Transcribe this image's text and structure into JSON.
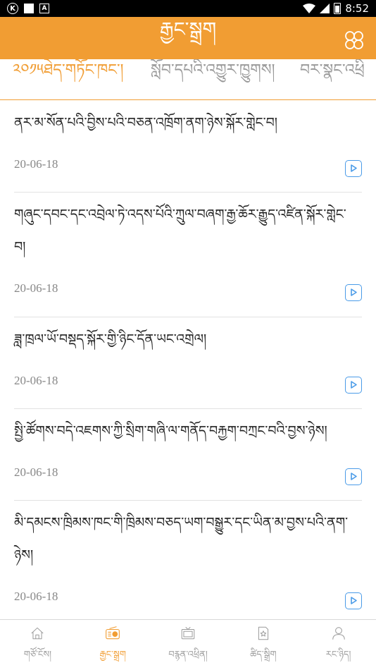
{
  "status_bar": {
    "time": "8:52",
    "left_icons": [
      "k-circle-icon",
      "square-icon",
      "a-box-icon"
    ],
    "right_icons": [
      "wifi-icon",
      "signal-icon",
      "battery-icon"
    ]
  },
  "header": {
    "title": "རྒྱང་སྒྲག",
    "menu_icon": "grid-menu-icon",
    "accent_color": "#f19d33"
  },
  "tabs": [
    {
      "label": "༢༠༡༥ཐེད་གཏོང་ཁང་།",
      "active": true
    },
    {
      "label": "སློབ་དཔའི་འགྱུར་ཁྱུགས།",
      "active": false
    },
    {
      "label": "བར་སྣང་འཕྲི",
      "active": false
    }
  ],
  "news": [
    {
      "title": "ནར་མ་སོན་པའི་བྱིས་པའི་བཅན་འཁྲོག་ནག་ཉེས་སྐོར་གླེང་བ།",
      "date": "20-06-18"
    },
    {
      "title": "གཞུང་དབང་དང་འབྲེལ་ཏེ་འདས་པོའི་ཀྲུལ་བཞག་རྒྱ་ཆོར་རྒྱུད་འཛིན་སྐོར་གླེང་བ།",
      "date": "20-06-18"
    },
    {
      "title": "ཟླ་ཁྲལ་ཡོ་བསྡད་སྐོར་གྱི་ཉིང་དོན་ཡང་འགྲེལ།",
      "date": "20-06-18"
    },
    {
      "title": "སྤྱི་ཚོགས་བདེ་འཇགས་ཀྱི་སྲིག་གཞི་ལ་གནོད་བརྐྱག་བཀྲང་བའི་བྱས་ཉེས།",
      "date": "20-06-18"
    },
    {
      "title": "མི་དམངས་ཁྲིམས་ཁང་གི་ཁྲིམས་བཅད་ཡག་བསྒྱུར་དང་ཡིན་མ་བྱས་པའི་ནག་ཉེས།",
      "date": "20-06-18"
    }
  ],
  "bottom_nav": [
    {
      "label": "གཙོ་ངོས།",
      "icon": "home-icon",
      "active": false
    },
    {
      "label": "རྒྱང་སྒྲག",
      "icon": "radio-icon",
      "active": true
    },
    {
      "label": "བརྙན་འཕྲིན།",
      "icon": "tv-icon",
      "active": false
    },
    {
      "label": "ཚིད་སྒྲིག",
      "icon": "bookmark-star-icon",
      "active": false
    },
    {
      "label": "རང་ཉིད།",
      "icon": "user-icon",
      "active": false
    }
  ]
}
